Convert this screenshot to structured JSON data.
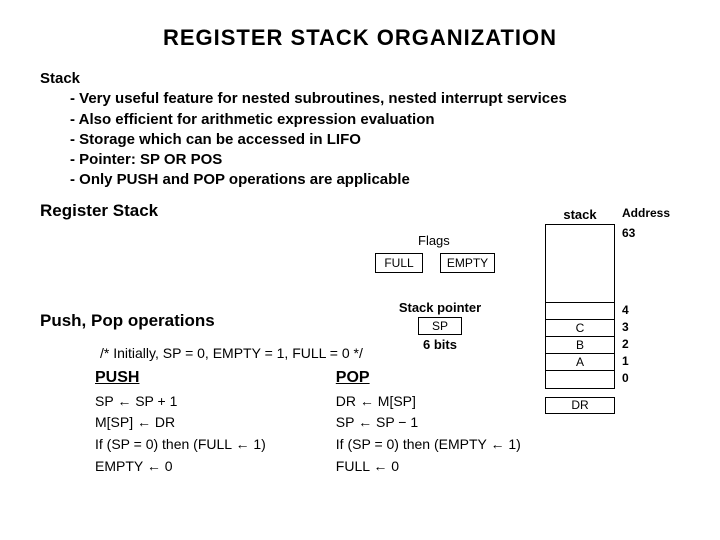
{
  "title": "REGISTER  STACK  ORGANIZATION",
  "stack": {
    "heading": "Stack",
    "bullets": [
      "- Very useful feature for nested subroutines, nested interrupt services",
      "- Also efficient for arithmetic expression evaluation",
      "- Storage which can be accessed in LIFO",
      "- Pointer: SP OR POS",
      "- Only PUSH and POP operations are applicable"
    ]
  },
  "reg_title": "Register Stack",
  "pushpop_title": "Push, Pop operations",
  "diagram": {
    "flags_label": "Flags",
    "full": "FULL",
    "empty": "EMPTY",
    "sp_label": "Stack pointer",
    "sp": "SP",
    "sp_bits": "6 bits",
    "stack_label": "stack",
    "rows": [
      "",
      "C",
      "B",
      "A",
      ""
    ],
    "addr_label": "Address",
    "addrs_top": "63",
    "addrs": [
      "4",
      "3",
      "2",
      "1",
      "0"
    ],
    "dr": "DR"
  },
  "ops": {
    "init": "/*  Initially, SP = 0, EMPTY = 1, FULL = 0  */",
    "push_title": "PUSH",
    "push": [
      "SP ← SP + 1",
      "M[SP] ← DR",
      "If (SP = 0) then (FULL ← 1)",
      "EMPTY ← 0"
    ],
    "pop_title": "POP",
    "pop": [
      "DR ← M[SP]",
      "SP ← SP − 1",
      "If (SP = 0) then (EMPTY ← 1)",
      "FULL ← 0"
    ]
  }
}
